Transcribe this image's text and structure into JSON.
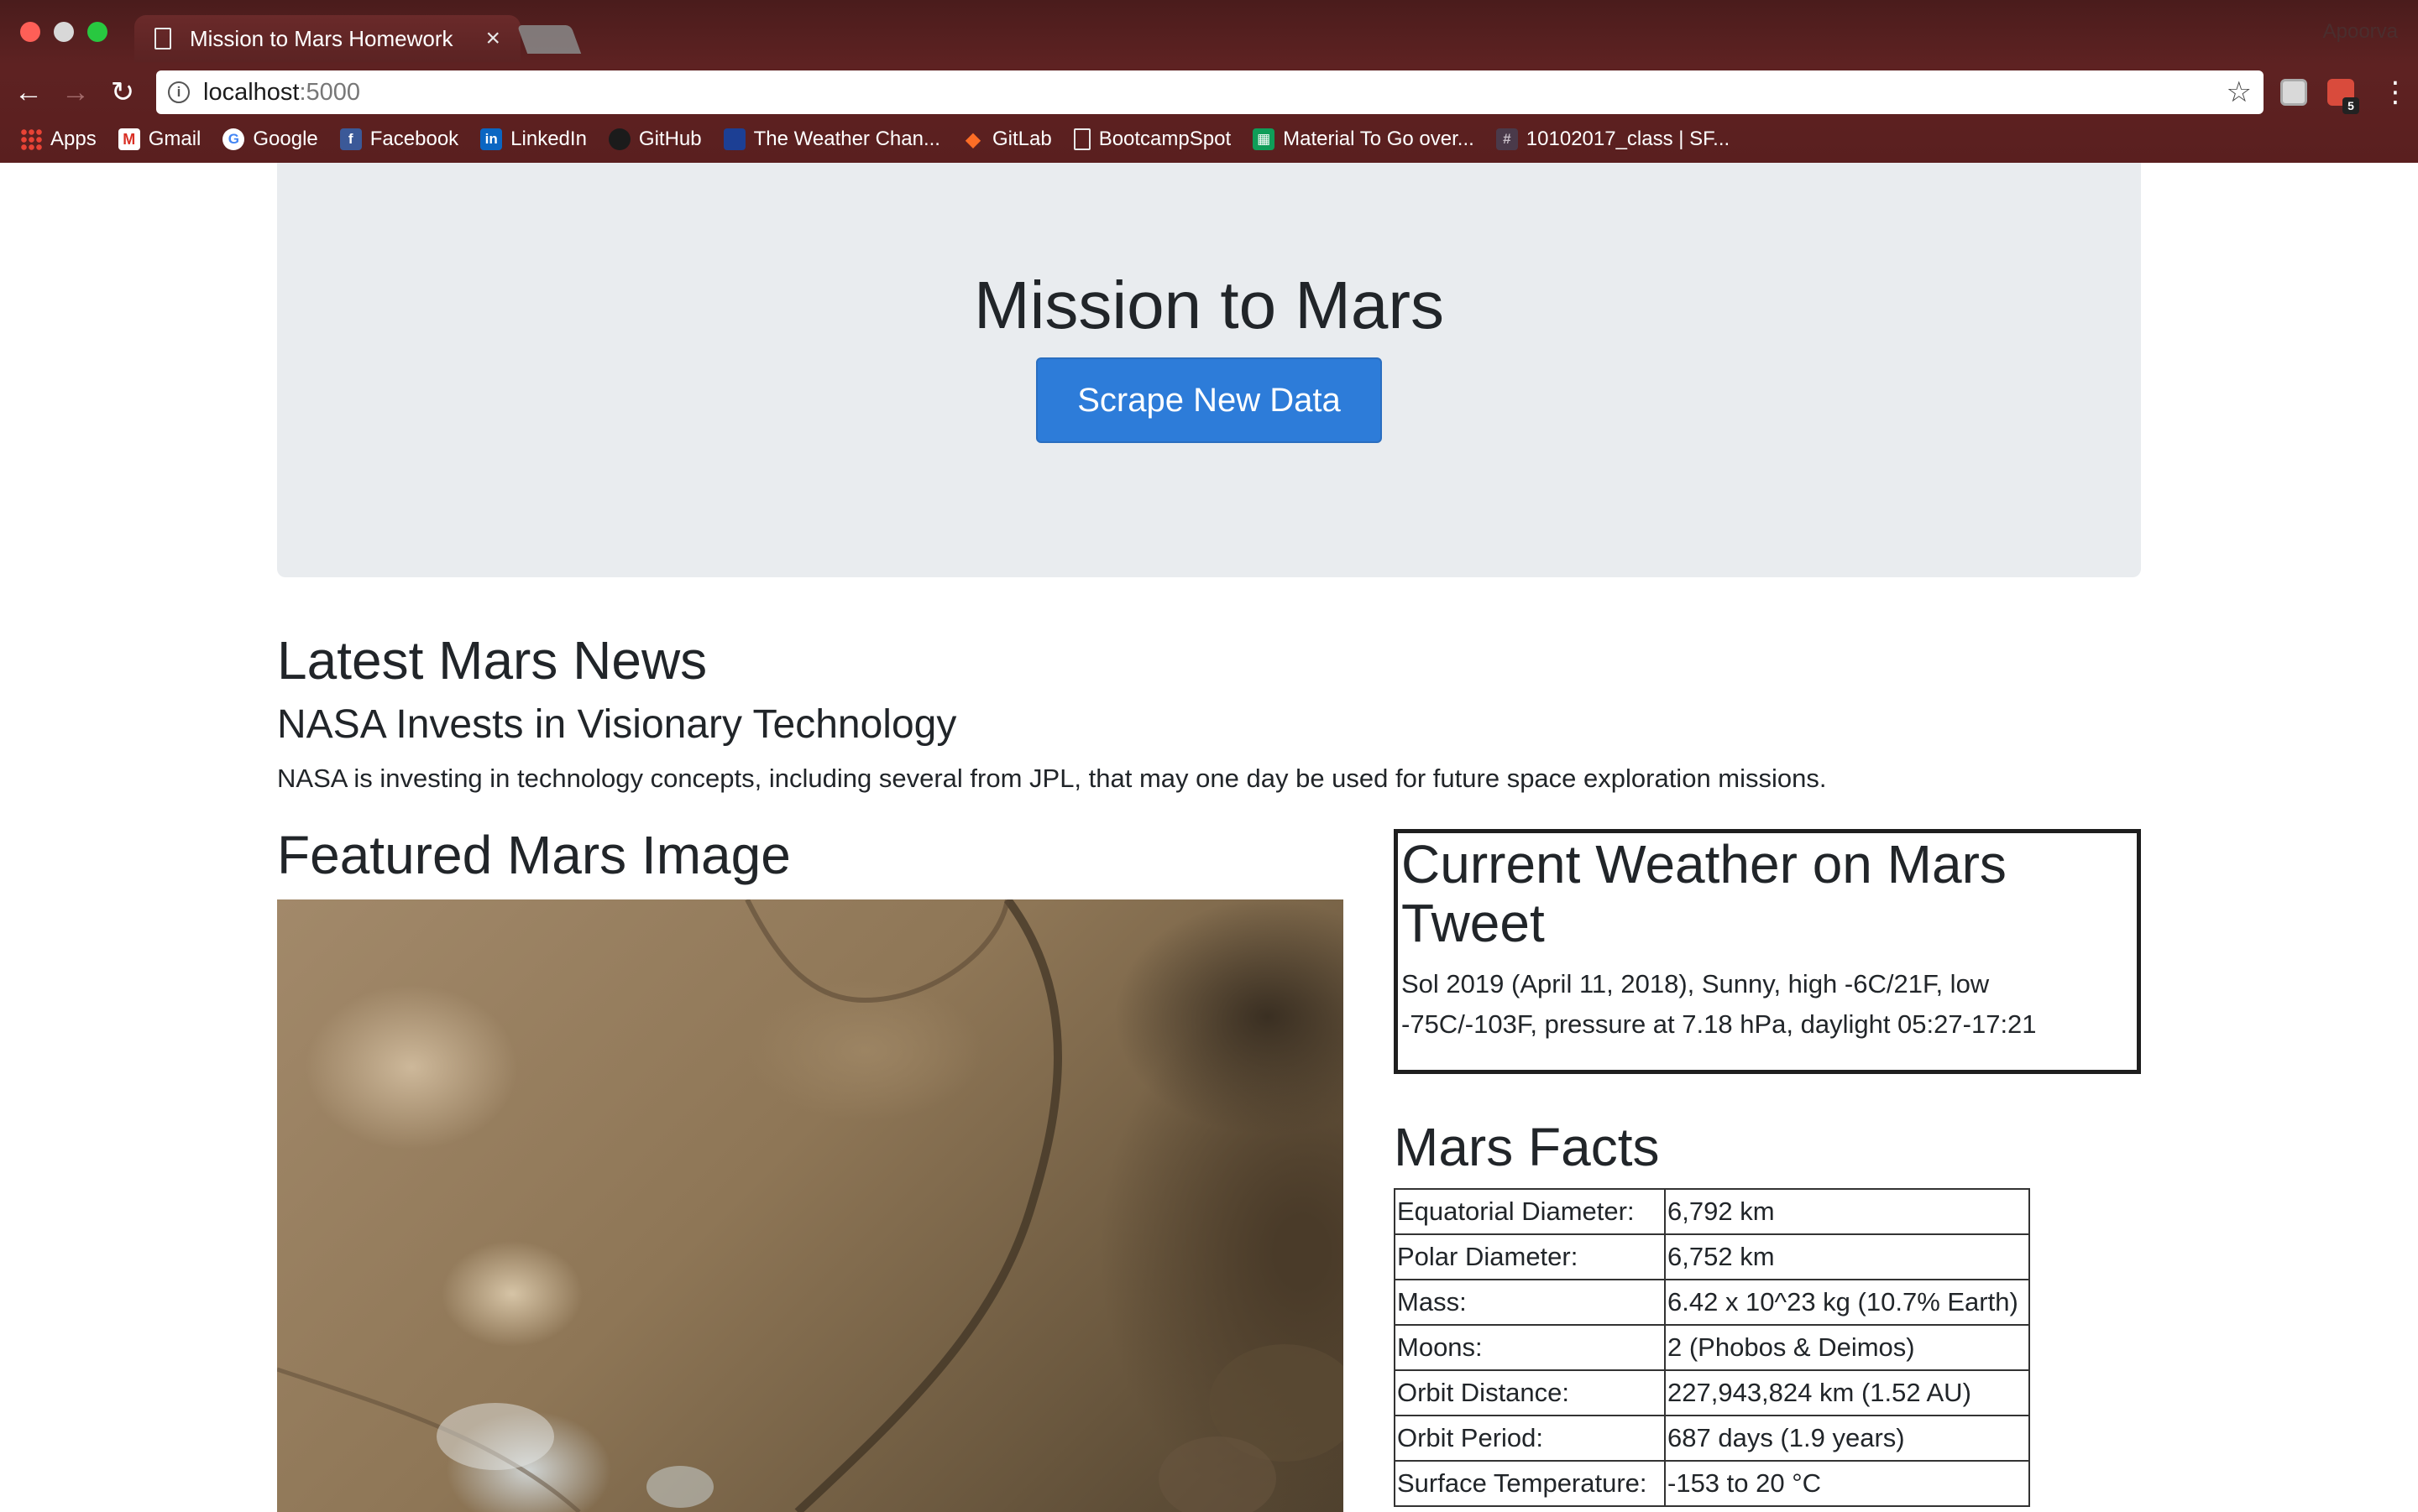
{
  "browser": {
    "tab_title": "Mission to Mars Homework",
    "tab_close": "×",
    "profile_name": "Apoorva",
    "url_host": "localhost",
    "url_port": ":5000",
    "bookmarks": [
      {
        "label": "Apps",
        "icon": "apps-grid-icon"
      },
      {
        "label": "Gmail",
        "icon": "gmail-icon"
      },
      {
        "label": "Google",
        "icon": "google-icon"
      },
      {
        "label": "Facebook",
        "icon": "facebook-icon"
      },
      {
        "label": "LinkedIn",
        "icon": "linkedin-icon"
      },
      {
        "label": "GitHub",
        "icon": "github-icon"
      },
      {
        "label": "The Weather Chan...",
        "icon": "weather-channel-icon"
      },
      {
        "label": "GitLab",
        "icon": "gitlab-icon"
      },
      {
        "label": "BootcampSpot",
        "icon": "document-icon"
      },
      {
        "label": "Material To Go over...",
        "icon": "sheets-icon"
      },
      {
        "label": "10102017_class | SF...",
        "icon": "slack-hash-icon"
      }
    ],
    "extension_badge": "5"
  },
  "jumbotron": {
    "title": "Mission to Mars",
    "button_label": "Scrape New Data"
  },
  "news": {
    "heading": "Latest Mars News",
    "title": "NASA Invests in Visionary Technology",
    "paragraph": "NASA is investing in technology concepts, including several from JPL, that may one day be used for future space exploration missions."
  },
  "featured": {
    "heading": "Featured Mars Image"
  },
  "weather": {
    "heading_line1": "Current Weather on Mars",
    "heading_line2": "Tweet",
    "text": "Sol 2019 (April 11, 2018), Sunny, high -6C/21F, low -75C/-103F, pressure at 7.18 hPa, daylight 05:27-17:21"
  },
  "facts": {
    "heading": "Mars Facts",
    "rows": [
      {
        "key": "Equatorial Diameter:",
        "value": "6,792 km"
      },
      {
        "key": "Polar Diameter:",
        "value": "6,752 km"
      },
      {
        "key": "Mass:",
        "value": "6.42 x 10^23 kg (10.7% Earth)"
      },
      {
        "key": "Moons:",
        "value": "2 (Phobos & Deimos)"
      },
      {
        "key": "Orbit Distance:",
        "value": "227,943,824 km (1.52 AU)"
      },
      {
        "key": "Orbit Period:",
        "value": "687 days (1.9 years)"
      },
      {
        "key": "Surface Temperature:",
        "value": "-153 to 20 °C"
      }
    ]
  },
  "colors": {
    "chrome_bg": "#5e2222",
    "jumbotron_bg": "#e9ecef",
    "button_primary": "#2d7cd9"
  }
}
